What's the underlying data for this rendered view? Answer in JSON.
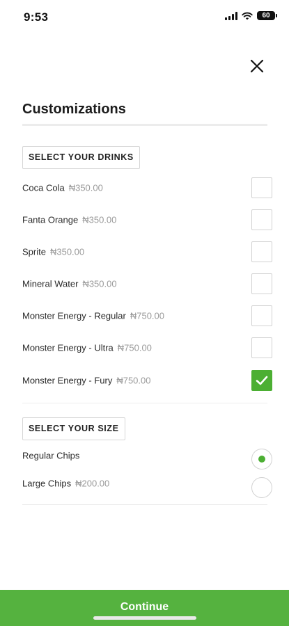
{
  "status_bar": {
    "time": "9:53",
    "battery": "60"
  },
  "header": {
    "title": "Customizations"
  },
  "drinks": {
    "section_label": "SELECT YOUR DRINKS",
    "items": [
      {
        "name": "Coca Cola",
        "price": "₦350.00",
        "checked": false
      },
      {
        "name": "Fanta Orange",
        "price": "₦350.00",
        "checked": false
      },
      {
        "name": "Sprite",
        "price": "₦350.00",
        "checked": false
      },
      {
        "name": "Mineral Water",
        "price": "₦350.00",
        "checked": false
      },
      {
        "name": "Monster Energy - Regular",
        "price": "₦750.00",
        "checked": false
      },
      {
        "name": "Monster Energy - Ultra",
        "price": "₦750.00",
        "checked": false
      },
      {
        "name": "Monster Energy - Fury",
        "price": "₦750.00",
        "checked": true
      }
    ]
  },
  "size": {
    "section_label": "SELECT YOUR SIZE",
    "items": [
      {
        "name": "Regular Chips",
        "price": "",
        "selected": true
      },
      {
        "name": "Large Chips",
        "price": "₦200.00",
        "selected": false
      }
    ]
  },
  "footer": {
    "continue_label": "Continue"
  },
  "colors": {
    "accent": "#4caf33",
    "continue_bg": "#55b23f"
  },
  "icons": {
    "close": "close-icon",
    "check": "checkmark-icon"
  }
}
